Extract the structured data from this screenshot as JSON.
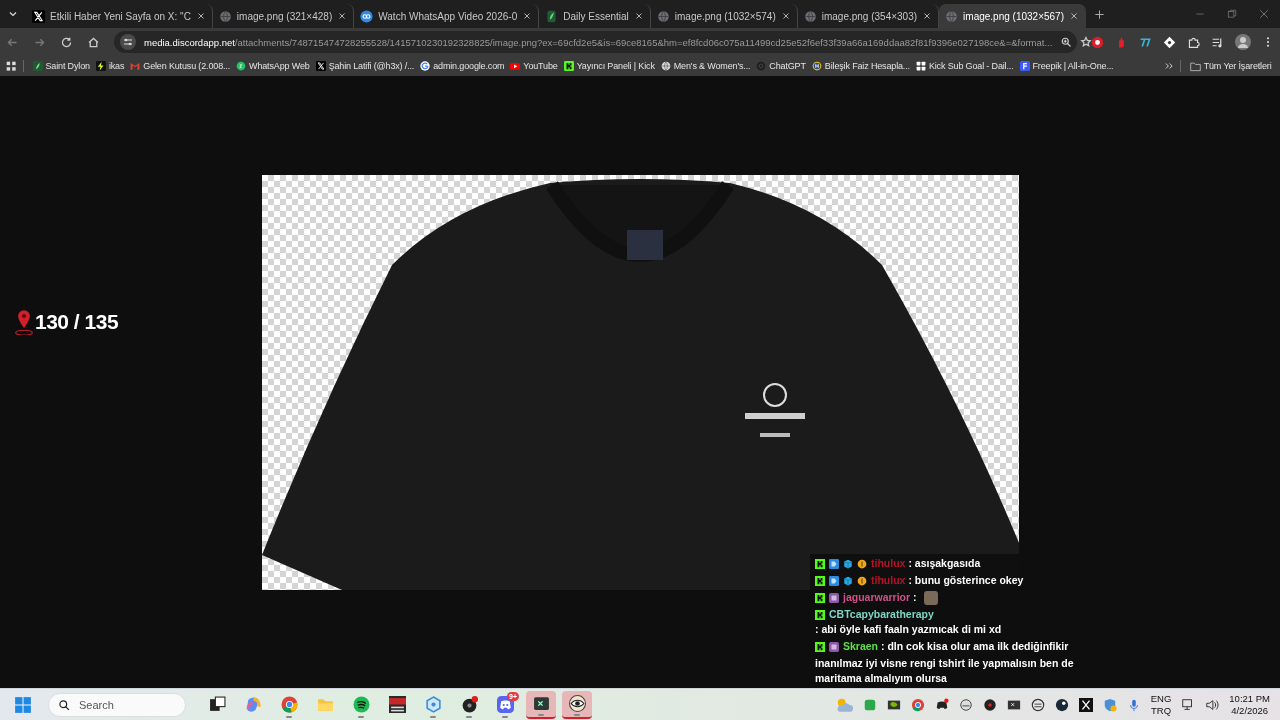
{
  "tabs": [
    {
      "title": "Etkili Haber Yeni Sayfa on X: \"C",
      "selected": false
    },
    {
      "title": "image.png (321×428)",
      "selected": false
    },
    {
      "title": "Watch WhatsApp Video 2026-0",
      "selected": false
    },
    {
      "title": "Daily Essential",
      "selected": false
    },
    {
      "title": "image.png (1032×574)",
      "selected": false
    },
    {
      "title": "image.png (354×303)",
      "selected": false
    },
    {
      "title": "image.png (1032×567)",
      "selected": true
    }
  ],
  "address": {
    "host": "media.discordapp.net",
    "path": "/attachments/748715474728255528/1415710230192328825/image.png?ex=69cfd2e5&is=69ce8165&hm=ef8fcd06c075a11499cd25e52f6ef33f39a66a169ddaa82f81f9396e027198ce&=&format..."
  },
  "bookmarks": [
    "Saint Dylon",
    "ikas",
    "Gelen Kutusu (2.008...",
    "WhatsApp Web",
    "Şahin Latifi (@h3x) /...",
    "admin.google.com",
    "YouTube",
    "Yayıncı Paneli | Kick",
    "Men's & Women's...",
    "ChatGPT",
    "Bileşik Faiz Hesapla...",
    "Kick Sub Goal - Dail...",
    "Freepik | All-in-One..."
  ],
  "all_bookmarks": "Tüm Yer İşaretleri",
  "counter": "130 / 135",
  "chat": [
    {
      "kind": "message",
      "user": "tihulux",
      "color": "#b3142a",
      "badges": [
        {
          "kind": "kick"
        },
        {
          "kind": "prime"
        },
        {
          "kind": "gifter"
        },
        {
          "kind": "sub"
        }
      ],
      "text": ": asışakgasıda",
      "emote": false
    },
    {
      "kind": "message",
      "user": "tihulux",
      "color": "#b3142a",
      "badges": [
        {
          "kind": "kick"
        },
        {
          "kind": "prime"
        },
        {
          "kind": "gifter"
        },
        {
          "kind": "sub"
        }
      ],
      "text": ": bunu gösterince okey",
      "emote": false
    },
    {
      "kind": "message",
      "user": "jaguarwarrior",
      "color": "#d0508a",
      "badges": [
        {
          "kind": "kick"
        },
        {
          "kind": "founder"
        }
      ],
      "text": ":",
      "emote": true
    },
    {
      "kind": "message",
      "user": "CBTcapybaratherapy",
      "color": "#7fd6c6",
      "badges": [
        {
          "kind": "kick"
        }
      ],
      "text": ": abi öyle kafi faaln yazmıcak di mi xd",
      "emote": false
    },
    {
      "kind": "message",
      "user": "Skraen",
      "color": "#5fe04a",
      "badges": [
        {
          "kind": "kick"
        },
        {
          "kind": "founder"
        }
      ],
      "text": ": dln cok kisa olur ama ilk dediğinfikir",
      "emote": false
    },
    {
      "kind": "plain",
      "text": "inanılmaz iyi visne rengi tshirt ile yapmalısın ben de maritama almalıyım olursa"
    }
  ],
  "taskbar": {
    "search_placeholder": "Search",
    "apps": [
      {
        "running": false,
        "alert": false
      },
      {
        "running": false,
        "alert": false
      },
      {
        "running": true,
        "alert": false
      },
      {
        "running": false,
        "alert": false
      },
      {
        "running": true,
        "alert": false
      },
      {
        "running": false,
        "alert": false
      },
      {
        "running": true,
        "alert": false
      },
      {
        "running": true,
        "alert": false
      },
      {
        "running": true,
        "alert": false,
        "badge": "9+"
      },
      {
        "running": true,
        "alert": true
      },
      {
        "running": true,
        "alert": true
      }
    ],
    "language": [
      "ENG",
      "TRQ"
    ],
    "time": "10:21 PM",
    "date": "4/2/2026"
  }
}
